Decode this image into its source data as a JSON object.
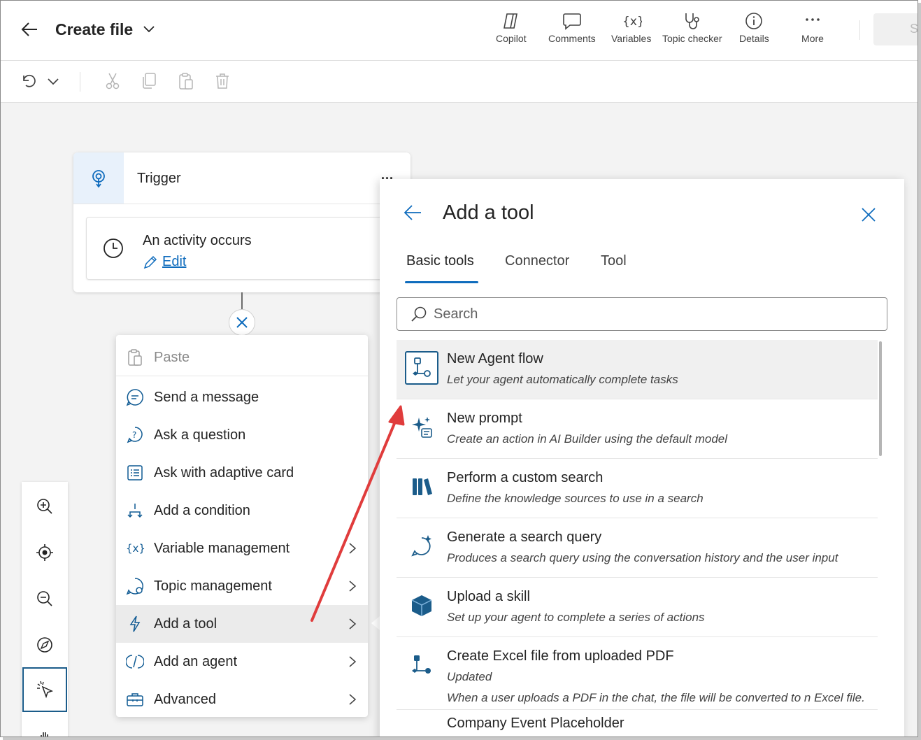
{
  "header": {
    "title": "Create file",
    "buttons": [
      {
        "label": "Copilot",
        "icon": "copilot-icon"
      },
      {
        "label": "Comments",
        "icon": "comment-icon"
      },
      {
        "label": "Variables",
        "icon": "variables-icon"
      },
      {
        "label": "Topic checker",
        "icon": "stethoscope-icon"
      },
      {
        "label": "Details",
        "icon": "info-icon"
      },
      {
        "label": "More",
        "icon": "more-icon"
      }
    ],
    "save_label": "S"
  },
  "toolbar": {
    "icons": [
      "undo-icon",
      "chevron-down-icon",
      "cut-icon",
      "copy-icon",
      "paste-icon",
      "delete-icon"
    ]
  },
  "trigger": {
    "title": "Trigger",
    "more": "...",
    "activity_title": "An activity occurs",
    "edit_label": "Edit"
  },
  "context_menu": {
    "items": [
      {
        "label": "Paste",
        "icon": "paste-icon",
        "disabled": true,
        "submenu": false
      },
      {
        "label": "Send a message",
        "icon": "message-icon",
        "submenu": false
      },
      {
        "label": "Ask a question",
        "icon": "question-icon",
        "submenu": false
      },
      {
        "label": "Ask with adaptive card",
        "icon": "adaptive-card-icon",
        "submenu": false
      },
      {
        "label": "Add a condition",
        "icon": "condition-icon",
        "submenu": false
      },
      {
        "label": "Variable management",
        "icon": "variables-icon",
        "submenu": true
      },
      {
        "label": "Topic management",
        "icon": "topic-icon",
        "submenu": true
      },
      {
        "label": "Add a tool",
        "icon": "flash-icon",
        "submenu": true,
        "active": true
      },
      {
        "label": "Add an agent",
        "icon": "agent-icon",
        "submenu": true
      },
      {
        "label": "Advanced",
        "icon": "toolbox-icon",
        "submenu": true
      }
    ]
  },
  "zoom_rail": {
    "icons": [
      "zoom-in-icon",
      "recenter-icon",
      "zoom-out-icon",
      "minimap-icon",
      "select-cursor-icon",
      "hand-icon"
    ]
  },
  "panel": {
    "title": "Add a tool",
    "tabs": [
      {
        "label": "Basic tools",
        "active": true
      },
      {
        "label": "Connector",
        "active": false
      },
      {
        "label": "Tool",
        "active": false
      }
    ],
    "search_placeholder": "Search",
    "tools": [
      {
        "title": "New Agent flow",
        "desc": "Let your agent automatically complete tasks",
        "icon": "agent-flow-icon"
      },
      {
        "title": "New prompt",
        "desc": "Create an action in AI Builder using the default model",
        "icon": "prompt-sparkle-icon"
      },
      {
        "title": "Perform a custom search",
        "desc": "Define the knowledge sources to use in a search",
        "icon": "library-icon"
      },
      {
        "title": "Generate a search query",
        "desc": "Produces a search query using the conversation history and the user input",
        "icon": "chat-sparkle-icon"
      },
      {
        "title": "Upload a skill",
        "desc": "Set up your agent to complete a series of actions",
        "icon": "cube-icon"
      },
      {
        "title": "Create Excel file from uploaded PDF",
        "desc": "Updated",
        "desc2": "When a user uploads a PDF in the chat, the file will be converted to n Excel file.",
        "icon": "flow-icon"
      },
      {
        "title": "Company Event Placeholder",
        "desc": "",
        "icon": "flow-icon"
      }
    ]
  },
  "colors": {
    "accent": "#0f6cbd",
    "tool_icon": "#1b5c8a",
    "annotation_arrow": "#e03c3c"
  }
}
